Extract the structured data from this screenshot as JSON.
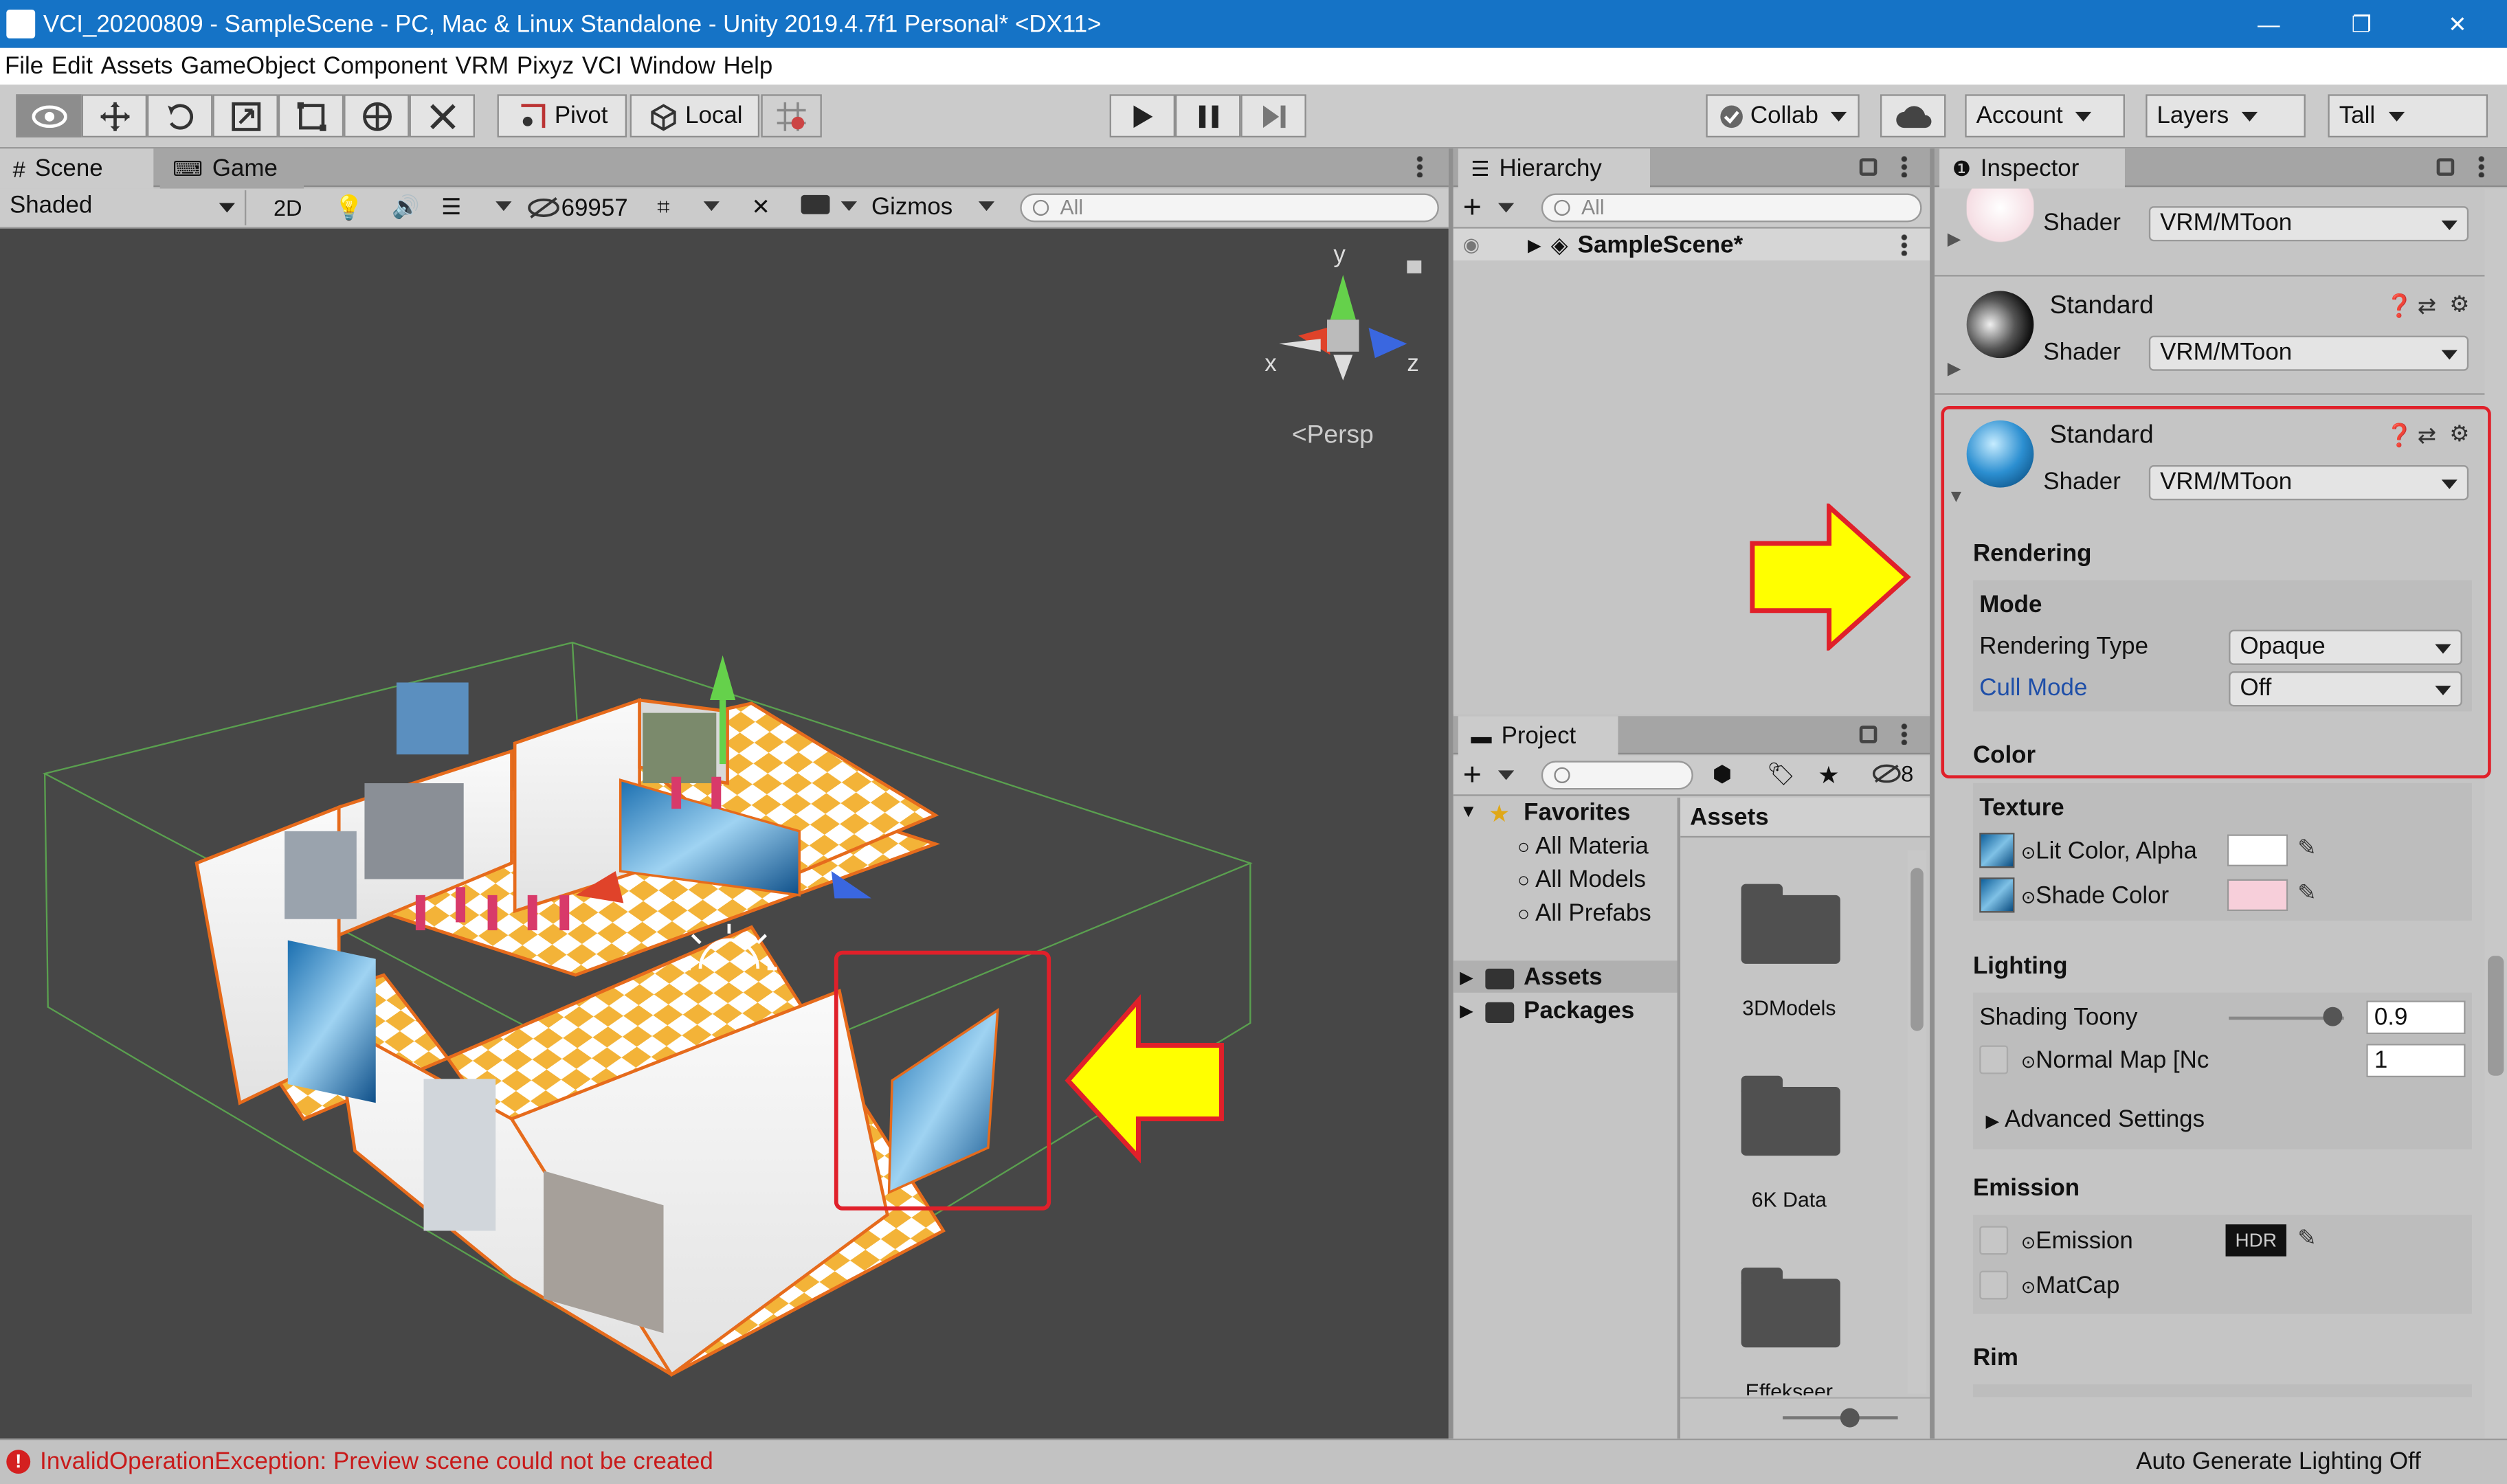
{
  "window": {
    "title": "VCI_20200809 - SampleScene - PC, Mac & Linux Standalone - Unity 2019.4.7f1 Personal* <DX11>",
    "minimize": "—",
    "maximize": "❐",
    "close": "✕"
  },
  "menu": [
    "File",
    "Edit",
    "Assets",
    "GameObject",
    "Component",
    "VRM",
    "Pixyz",
    "VCI",
    "Window",
    "Help"
  ],
  "toolbar": {
    "pivot": "Pivot",
    "local": "Local",
    "collab": "Collab",
    "account": "Account",
    "layers": "Layers",
    "layout": "Tall"
  },
  "scene": {
    "tab_scene": "Scene",
    "tab_game": "Game",
    "shading": "Shaded",
    "mode_2d": "2D",
    "hidden_count": "69957",
    "gizmos": "Gizmos",
    "search_placeholder": "All",
    "axis_x": "x",
    "axis_y": "y",
    "axis_z": "z",
    "persp": "Persp"
  },
  "hierarchy": {
    "tab": "Hierarchy",
    "search_placeholder": "All",
    "scene_name": "SampleScene*"
  },
  "project": {
    "tab": "Project",
    "hidden_count": "8",
    "favorites": "Favorites",
    "fav_items": [
      "All Materia",
      "All Models",
      "All Prefabs"
    ],
    "tree": [
      "Assets",
      "Packages"
    ],
    "breadcrumb": "Assets",
    "folders": [
      "3DModels",
      "6K Data",
      "Effekseer"
    ]
  },
  "inspector": {
    "tab": "Inspector",
    "shader_label": "Shader",
    "mat1_shader": "VRM/MToon",
    "mat2_name": "Standard",
    "mat2_shader": "VRM/MToon",
    "mat3_name": "Standard",
    "mat3_shader": "VRM/MToon",
    "rendering": "Rendering",
    "mode": "Mode",
    "rendering_type_label": "Rendering Type",
    "rendering_type_value": "Opaque",
    "cull_mode_label": "Cull Mode",
    "cull_mode_value": "Off",
    "color": "Color",
    "texture": "Texture",
    "lit_color": "Lit Color, Alpha",
    "shade_color": "Shade Color",
    "lighting": "Lighting",
    "shading_toony_label": "Shading Toony",
    "shading_toony_value": "0.9",
    "shading_toony_level": 0.9,
    "normal_map": "Normal Map [Nc",
    "normal_map_value": "1",
    "advanced_settings": "Advanced Settings",
    "emission_section": "Emission",
    "emission": "Emission",
    "hdr": "HDR",
    "matcap": "MatCap",
    "rim": "Rim"
  },
  "status": {
    "error": "InvalidOperationException: Preview scene could not be created",
    "right": "Auto Generate Lighting Off"
  },
  "colors": {
    "highlight_red": "#e0202a",
    "arrow_yellow": "#ffff00",
    "title_blue": "#1573c6",
    "link_blue": "#1f4fa8"
  }
}
